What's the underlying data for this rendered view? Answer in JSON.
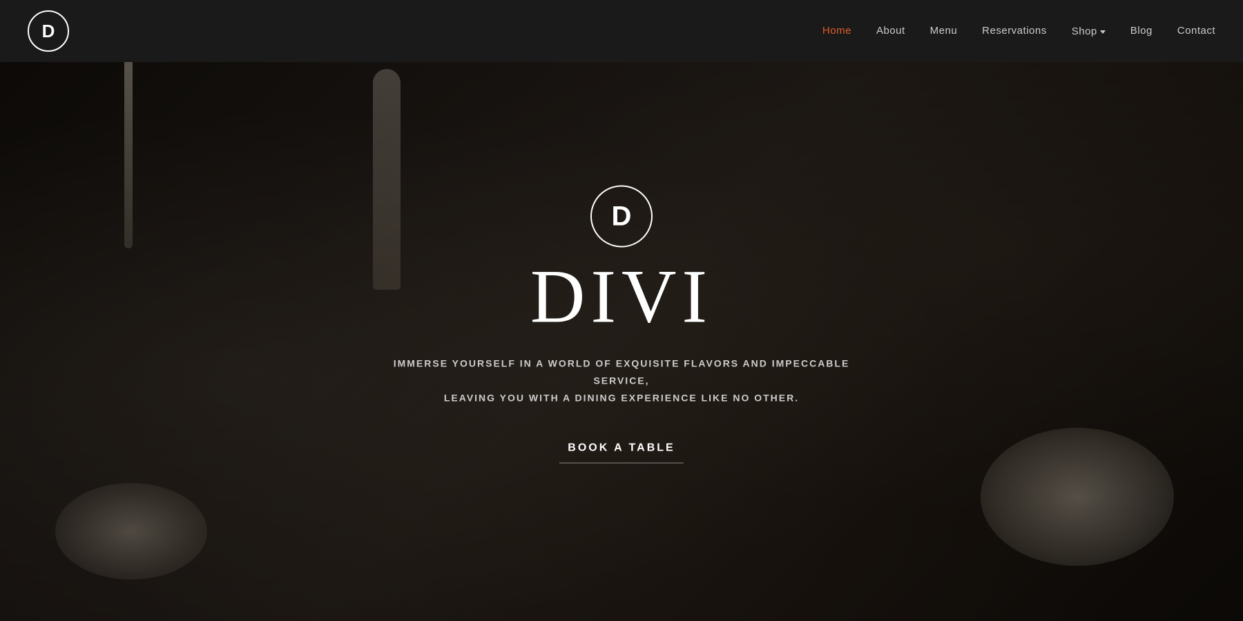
{
  "navbar": {
    "logo_letter": "D",
    "links": [
      {
        "label": "Home",
        "active": true
      },
      {
        "label": "About",
        "active": false
      },
      {
        "label": "Menu",
        "active": false
      },
      {
        "label": "Reservations",
        "active": false
      },
      {
        "label": "Shop",
        "active": false,
        "has_dropdown": true
      },
      {
        "label": "Blog",
        "active": false
      },
      {
        "label": "Contact",
        "active": false
      }
    ]
  },
  "hero": {
    "logo_letter": "D",
    "title": "DIVI",
    "subtitle_line1": "IMMERSE YOURSELF IN A WORLD OF EXQUISITE FLAVORS AND IMPECCABLE SERVICE,",
    "subtitle_line2": "LEAVING YOU WITH A DINING EXPERIENCE LIKE NO OTHER.",
    "cta_label": "BOOK A TABLE"
  },
  "colors": {
    "nav_active": "#e05c2a",
    "nav_text": "#cccccc",
    "hero_bg": "#2a2520",
    "white": "#ffffff"
  }
}
